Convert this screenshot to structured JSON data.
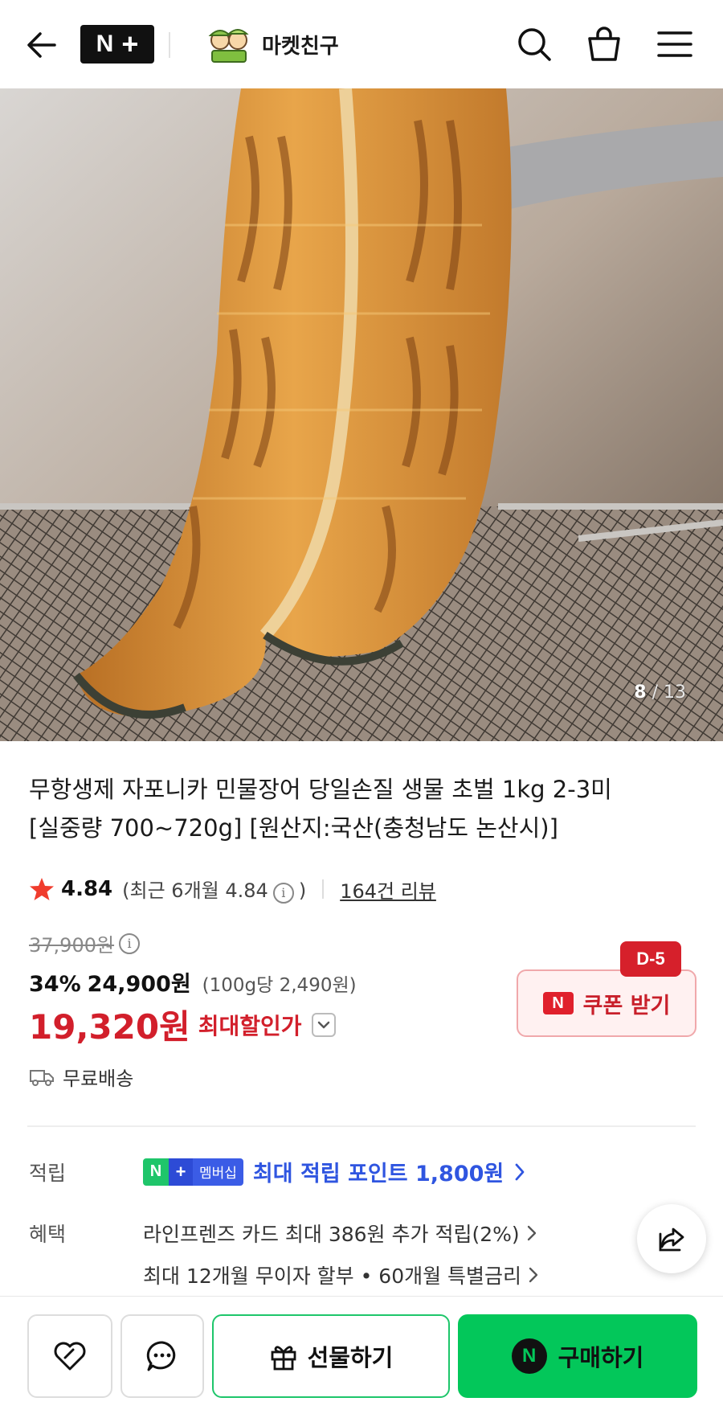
{
  "header": {
    "brand_badge_n": "N",
    "brand_badge_plus": "+",
    "store_name": "마켓친구"
  },
  "hero": {
    "counter_current": "8",
    "counter_total": " / 13"
  },
  "product": {
    "title_line1": "무항생제 자포니카 민물장어 당일손질 생물 초벌 1kg 2-3미",
    "title_line2": "[실중량 700~720g] [원산지:국산(충청남도 논산시)]",
    "rating": "4.84",
    "rating_recent_pre": "(최근 6개월 4.84",
    "rating_recent_post": ")",
    "review_count": "164건 리뷰",
    "original_price": "37,900원",
    "discount_pct": "34%",
    "sale_price": "24,900원",
    "unit_price": "(100g당 2,490원)",
    "max_discount_price": "19,320원",
    "max_discount_label": "최대할인가",
    "shipping": "무료배송"
  },
  "coupon": {
    "n_mark": "N",
    "label": "쿠폰 받기",
    "dday": "D-5"
  },
  "benefits": {
    "points_label": "적립",
    "member_badge_n": "N",
    "member_badge_plus": "+",
    "member_badge_text": "멤버십",
    "points_text": "최대 적립 포인트 1,800원",
    "benefit_label": "혜택",
    "benefit_line1": "라인프렌즈 카드 최대 386원 추가 적립(2%)",
    "benefit_line2": "최대 12개월 무이자 할부 • 60개월 특별금리"
  },
  "bottombar": {
    "gift_label": "선물하기",
    "buy_n": "N",
    "buy_label": "구매하기"
  },
  "colors": {
    "naver_green": "#03c75a",
    "price_red": "#d21f2b",
    "points_blue": "#2f55e0"
  },
  "icons": [
    "back-arrow-icon",
    "search-icon",
    "shopping-bag-icon",
    "menu-icon",
    "star-icon",
    "info-icon",
    "truck-icon",
    "chevron-right-icon",
    "chevron-down-icon",
    "share-icon",
    "heart-icon",
    "chat-icon",
    "gift-icon"
  ]
}
